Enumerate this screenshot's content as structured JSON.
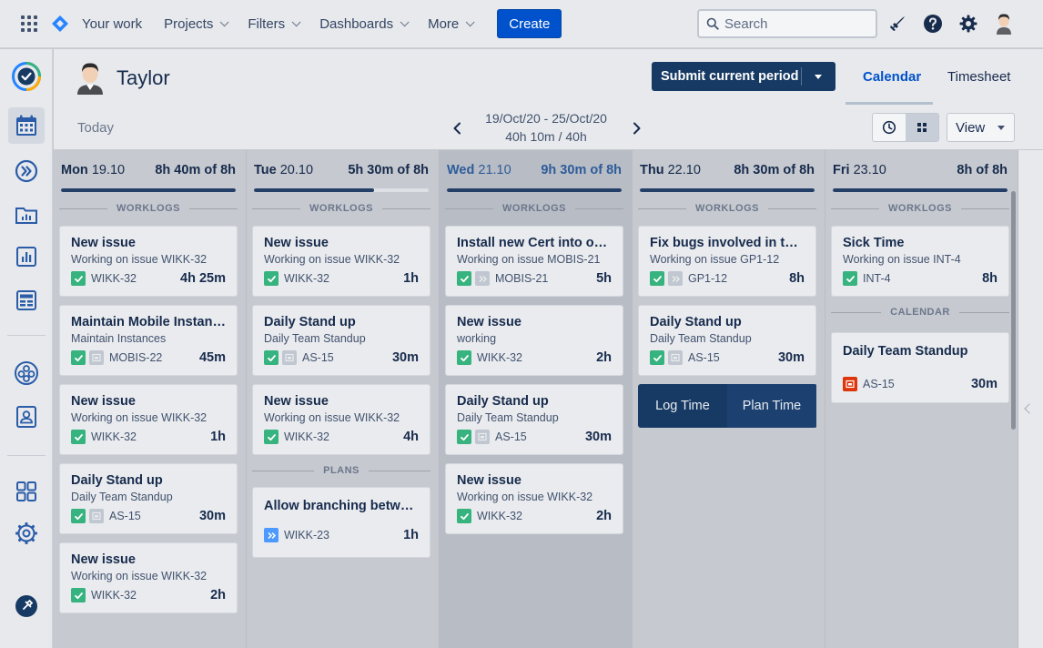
{
  "topnav": {
    "items": [
      {
        "label": "Your work",
        "dropdown": false
      },
      {
        "label": "Projects",
        "dropdown": true
      },
      {
        "label": "Filters",
        "dropdown": true
      },
      {
        "label": "Dashboards",
        "dropdown": true
      },
      {
        "label": "More",
        "dropdown": true
      }
    ],
    "create_label": "Create",
    "search_placeholder": "Search",
    "icons": [
      "notifications-icon",
      "help-icon",
      "settings-icon",
      "user-avatar"
    ]
  },
  "rail": {
    "icons": [
      "tempo-logo-icon",
      "calendar-icon",
      "forward-icon",
      "folder-chart-icon",
      "report-icon",
      "planner-icon",
      "team-icon",
      "profile-card-icon",
      "apps-grid-icon",
      "gear-icon",
      "pin-icon"
    ],
    "active": "calendar-icon"
  },
  "header": {
    "user_name": "Taylor",
    "submit_label": "Submit current period",
    "tabs": [
      "Calendar",
      "Timesheet"
    ],
    "active_tab": "Calendar",
    "today_label": "Today",
    "period_range": "19/Oct/20 - 25/Oct/20",
    "period_total": "40h 10m / 40h",
    "view_label": "View"
  },
  "labels": {
    "worklogs": "WORKLOGS",
    "plans": "PLANS",
    "calendar": "CALENDAR",
    "log_time": "Log Time",
    "plan_time": "Plan Time"
  },
  "colors": {
    "accent": "#0052cc",
    "navy": "#173a64",
    "check_green": "#36b37e",
    "today_text": "#2d5c9a"
  },
  "days": [
    {
      "name": "Mon",
      "date": "19.10",
      "total": "8h 40m of 8h",
      "progress": 1.0,
      "today": false,
      "worklogs": [
        {
          "title": "New issue",
          "desc": "Working on issue WIKK-32",
          "icons": [
            "check"
          ],
          "key": "WIKK-32",
          "duration": "4h 25m"
        },
        {
          "title": "Maintain Mobile Instance",
          "desc": "Maintain Instances",
          "icons": [
            "check",
            "meeting"
          ],
          "key": "MOBIS-22",
          "duration": "45m"
        },
        {
          "title": "New issue",
          "desc": "Working on issue WIKK-32",
          "icons": [
            "check"
          ],
          "key": "WIKK-32",
          "duration": "1h"
        },
        {
          "title": "Daily Stand up",
          "desc": "Daily Team Standup",
          "icons": [
            "check",
            "meeting"
          ],
          "key": "AS-15",
          "duration": "30m"
        },
        {
          "title": "New issue",
          "desc": "Working on issue WIKK-32",
          "icons": [
            "check"
          ],
          "key": "WIKK-32",
          "duration": "2h"
        }
      ]
    },
    {
      "name": "Tue",
      "date": "20.10",
      "total": "5h 30m of 8h",
      "progress": 0.69,
      "today": false,
      "worklogs": [
        {
          "title": "New issue",
          "desc": "Working on issue WIKK-32",
          "icons": [
            "check"
          ],
          "key": "WIKK-32",
          "duration": "1h"
        },
        {
          "title": "Daily Stand up",
          "desc": "Daily Team Standup",
          "icons": [
            "check",
            "meeting"
          ],
          "key": "AS-15",
          "duration": "30m"
        },
        {
          "title": "New issue",
          "desc": "Working on issue WIKK-32",
          "icons": [
            "check"
          ],
          "key": "WIKK-32",
          "duration": "4h"
        }
      ],
      "plans": [
        {
          "title": "Allow branching betwee...",
          "icons": [
            "epic-blue"
          ],
          "key": "WIKK-23",
          "duration": "1h"
        }
      ]
    },
    {
      "name": "Wed",
      "date": "21.10",
      "total": "9h 30m of 8h",
      "progress": 1.0,
      "today": true,
      "worklogs": [
        {
          "title": "Install new Cert into our...",
          "desc": "Working on issue MOBIS-21",
          "icons": [
            "check",
            "epic"
          ],
          "key": "MOBIS-21",
          "duration": "5h"
        },
        {
          "title": "New issue",
          "desc": "working",
          "icons": [
            "check"
          ],
          "key": "WIKK-32",
          "duration": "2h"
        },
        {
          "title": "Daily Stand up",
          "desc": "Daily Team Standup",
          "icons": [
            "check",
            "meeting"
          ],
          "key": "AS-15",
          "duration": "30m"
        },
        {
          "title": "New issue",
          "desc": "Working on issue WIKK-32",
          "icons": [
            "check"
          ],
          "key": "WIKK-32",
          "duration": "2h"
        }
      ]
    },
    {
      "name": "Thu",
      "date": "22.10",
      "total": "8h 30m of 8h",
      "progress": 1.0,
      "today": false,
      "worklogs": [
        {
          "title": "Fix bugs involved in the ...",
          "desc": "Working on issue GP1-12",
          "icons": [
            "check",
            "epic"
          ],
          "key": "GP1-12",
          "duration": "8h"
        },
        {
          "title": "Daily Stand up",
          "desc": "Daily Team Standup",
          "icons": [
            "check",
            "meeting"
          ],
          "key": "AS-15",
          "duration": "30m"
        }
      ],
      "log_plan": true
    },
    {
      "name": "Fri",
      "date": "23.10",
      "total": "8h of 8h",
      "progress": 1.0,
      "today": false,
      "worklogs": [
        {
          "title": "Sick Time",
          "desc": "Working on issue INT-4",
          "icons": [
            "check"
          ],
          "key": "INT-4",
          "duration": "8h"
        }
      ],
      "calendar": [
        {
          "title": "Daily Team Standup",
          "icons": [
            "meeting-red"
          ],
          "key": "AS-15",
          "duration": "30m"
        }
      ]
    }
  ]
}
